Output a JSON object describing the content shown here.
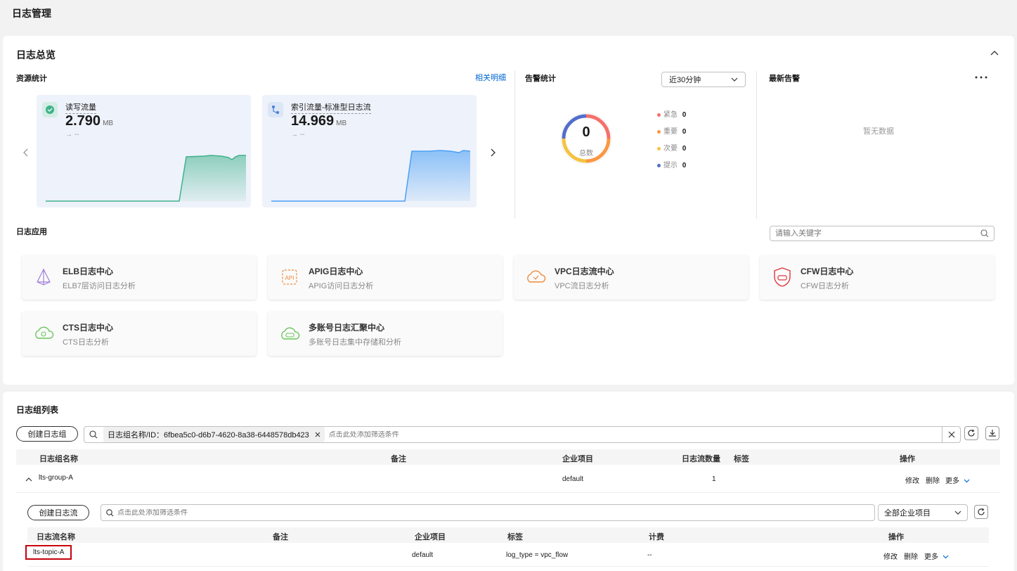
{
  "page_title": "日志管理",
  "overview": {
    "title": "日志总览",
    "resource": {
      "title": "资源统计",
      "related_link": "相关明细",
      "cards": [
        {
          "label": "读写流量",
          "value": "2.790",
          "unit": "MB",
          "trend": "→ --"
        },
        {
          "label": "索引流量-标准型日志流",
          "value": "14.969",
          "unit": "MB",
          "trend": "→ --"
        }
      ]
    },
    "alarm_stats": {
      "title": "告警统计",
      "range_select": "近30分钟",
      "total": "0",
      "total_label": "总数",
      "legend": [
        {
          "name": "紧急",
          "count": "0",
          "color": "#f66f6a"
        },
        {
          "name": "重要",
          "count": "0",
          "color": "#fa9841"
        },
        {
          "name": "次要",
          "count": "0",
          "color": "#f5c342"
        },
        {
          "name": "提示",
          "count": "0",
          "color": "#526ecc"
        }
      ]
    },
    "latest_alarm": {
      "title": "最新告警",
      "empty": "暂无数据",
      "more_icon": "more-icon"
    },
    "apps": {
      "title": "日志应用",
      "search_placeholder": "请输入关键字",
      "items": [
        {
          "title": "ELB日志中心",
          "desc": "ELB7层访问日志分析",
          "icon": "elb-icon"
        },
        {
          "title": "APIG日志中心",
          "desc": "APIG访问日志分析",
          "icon": "apig-icon"
        },
        {
          "title": "VPC日志流中心",
          "desc": "VPC流日志分析",
          "icon": "vpc-icon"
        },
        {
          "title": "CFW日志中心",
          "desc": "CFW日志分析",
          "icon": "cfw-icon"
        },
        {
          "title": "CTS日志中心",
          "desc": "CTS日志分析",
          "icon": "cts-icon"
        },
        {
          "title": "多账号日志汇聚中心",
          "desc": "多账号日志集中存储和分析",
          "icon": "multi-account-icon"
        }
      ]
    }
  },
  "group_list": {
    "title": "日志组列表",
    "create_button": "创建日志组",
    "filter_tag": "日志组名称/ID：6fbea5c0-d6b7-4620-8a38-6448578db423",
    "filter_placeholder": "点击此处添加筛选条件",
    "columns": [
      "日志组名称",
      "备注",
      "企业项目",
      "日志流数量",
      "标签",
      "操作"
    ],
    "rows": [
      {
        "name": "lts-group-A",
        "remark": "",
        "enterprise": "default",
        "stream_count": "1",
        "tags": "",
        "actions": [
          "修改",
          "删除",
          "更多"
        ]
      }
    ]
  },
  "stream_list": {
    "create_button": "创建日志流",
    "filter_placeholder": "点击此处添加筛选条件",
    "project_select": "全部企业项目",
    "columns": [
      "日志流名称",
      "备注",
      "企业项目",
      "标签",
      "计费",
      "操作"
    ],
    "rows": [
      {
        "name": "lts-topic-A",
        "remark": "",
        "enterprise": "default",
        "tags": "log_type = vpc_flow",
        "billing": "--",
        "actions": [
          "修改",
          "删除",
          "更多"
        ]
      }
    ]
  }
}
